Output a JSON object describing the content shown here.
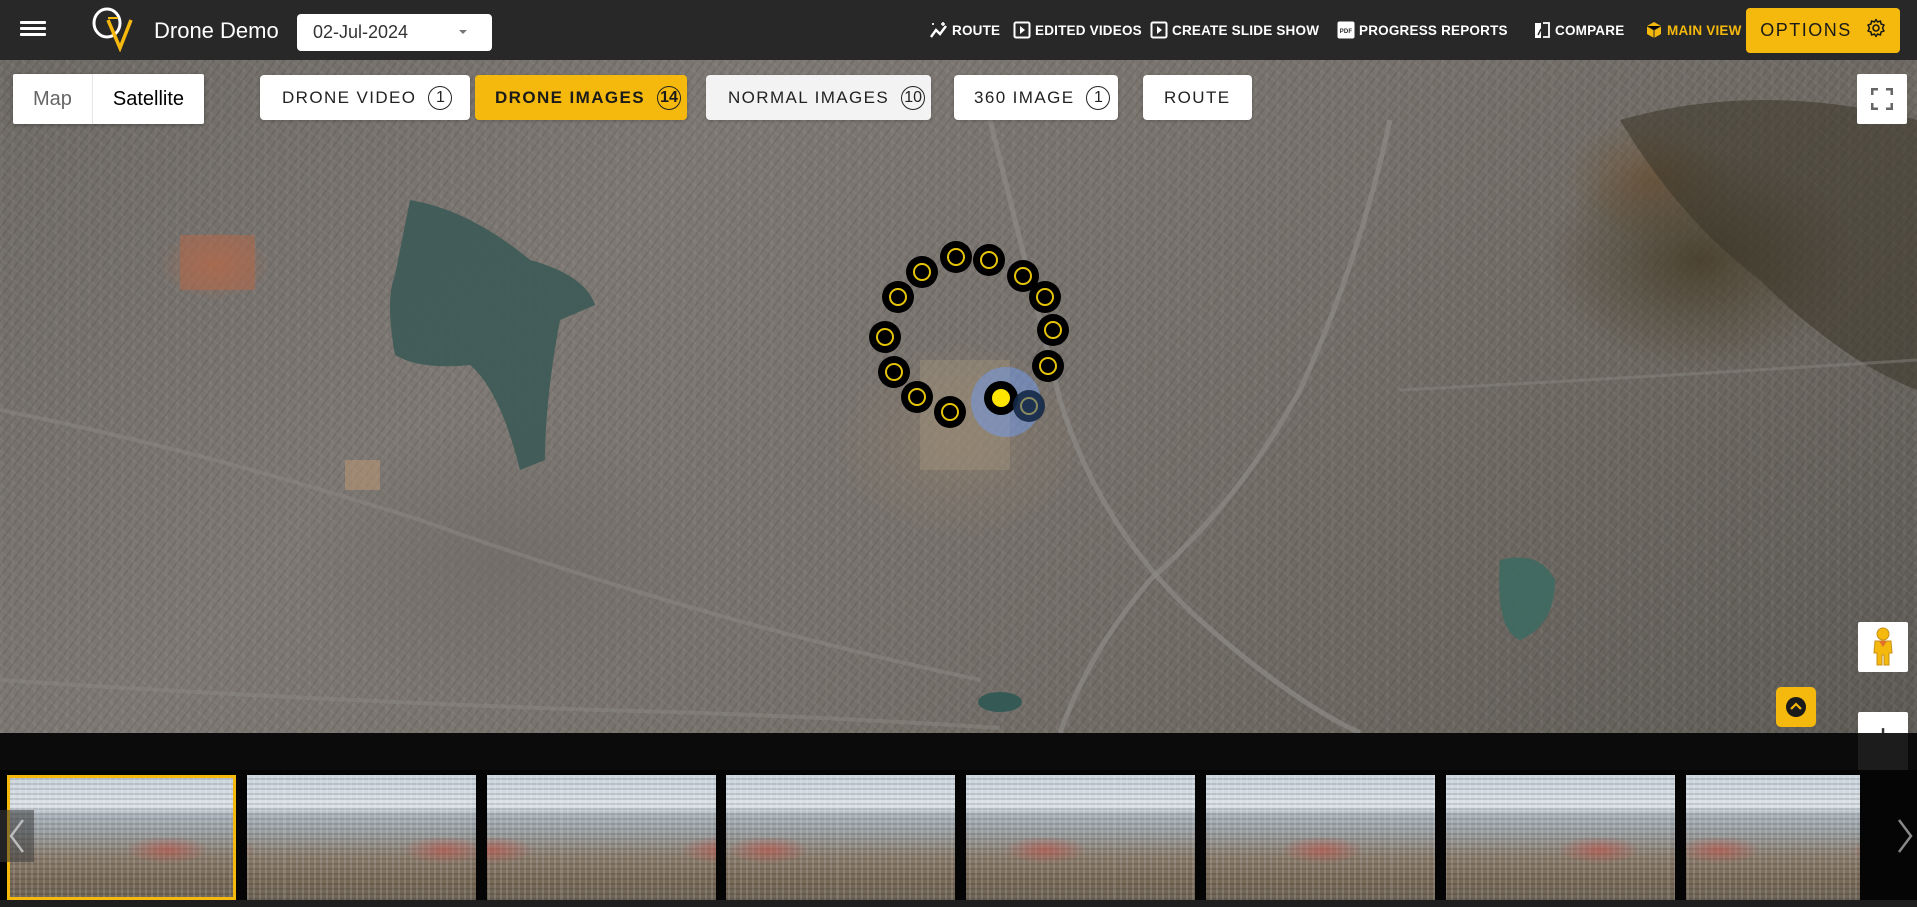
{
  "header": {
    "app_title": "Drone Demo",
    "date": "02-Jul-2024",
    "nav": [
      {
        "label": "ROUTE",
        "icon": "route-sparkle-icon"
      },
      {
        "label": "EDITED VIDEOS",
        "icon": "play-box-icon"
      },
      {
        "label": "CREATE SLIDE SHOW",
        "icon": "play-box-icon"
      },
      {
        "label": "PROGRESS REPORTS",
        "icon": "pdf-icon"
      },
      {
        "label": "COMPARE",
        "icon": "compare-icon"
      },
      {
        "label": "MAIN VIEW",
        "icon": "cube-icon",
        "active": true
      }
    ],
    "options_label": "OPTIONS"
  },
  "map": {
    "type_options": {
      "map": "Map",
      "satellite": "Satellite",
      "selected": "Satellite"
    },
    "filters": [
      {
        "label": "DRONE VIDEO",
        "count": "1",
        "state": "default"
      },
      {
        "label": "DRONE IMAGES",
        "count": "14",
        "state": "active"
      },
      {
        "label": "NORMAL IMAGES",
        "count": "10",
        "state": "hover"
      },
      {
        "label": "360 IMAGE",
        "count": "1",
        "state": "default"
      },
      {
        "label": "ROUTE",
        "count": null,
        "state": "default"
      }
    ],
    "markers_count": 14,
    "selected_marker": 1
  },
  "filmstrip": {
    "thumbnails_visible": 8,
    "selected_index": 0
  },
  "colors": {
    "accent": "#f5b90d",
    "topbar": "#282828",
    "marker": "#000000",
    "marker_ring": "#e6c40a",
    "current_marker": "#ffe600"
  }
}
